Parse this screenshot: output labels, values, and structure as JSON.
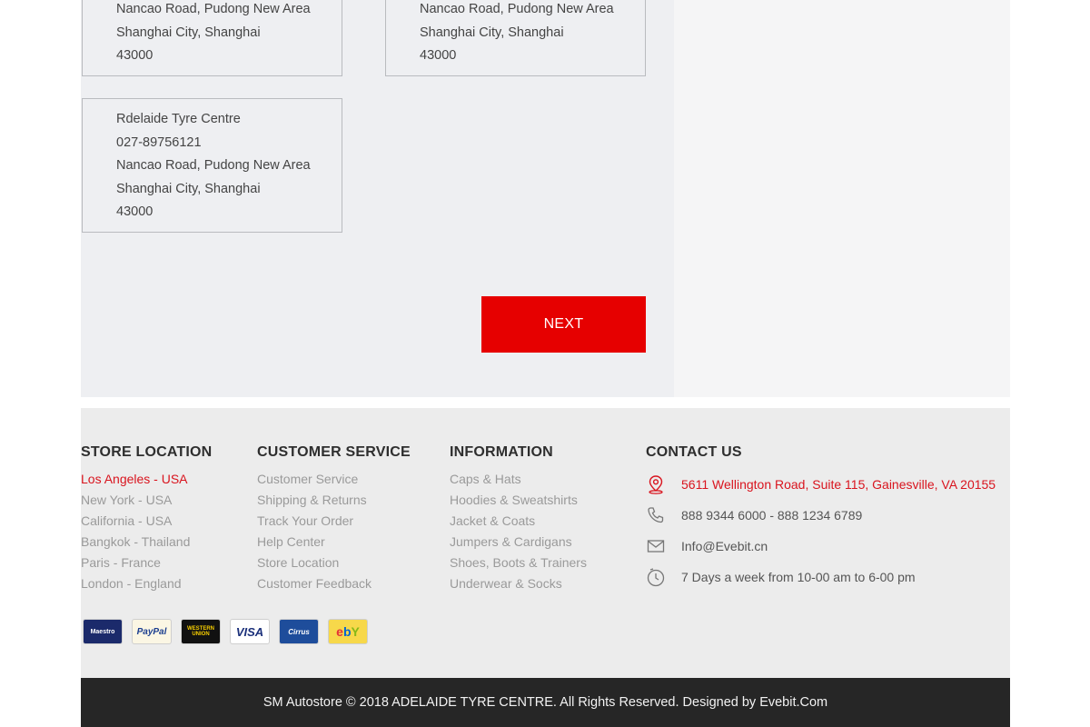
{
  "stores": [
    {
      "name": "",
      "phone": "",
      "street": "Nancao Road, Pudong New Area",
      "city": "Shanghai City, Shanghai",
      "zip": "43000"
    },
    {
      "name": "",
      "phone": "",
      "street": "Nancao Road, Pudong New Area",
      "city": "Shanghai City, Shanghai",
      "zip": "43000"
    },
    {
      "name": "Rdelaide Tyre Centre",
      "phone": "027-89756121",
      "street": "Nancao Road, Pudong New Area",
      "city": "Shanghai City, Shanghai",
      "zip": "43000"
    }
  ],
  "next_label": "NEXT",
  "footer": {
    "store_location": {
      "title": "STORE LOCATION",
      "items": [
        "Los Angeles - USA",
        "New York - USA",
        "California - USA",
        "Bangkok - Thailand",
        "Paris - France",
        "London - England"
      ]
    },
    "customer_service": {
      "title": "CUSTOMER SERVICE",
      "items": [
        "Customer Service",
        "Shipping & Returns",
        "Track Your Order",
        "Help Center",
        "Store Location",
        "Customer Feedback"
      ]
    },
    "information": {
      "title": "INFORMATION",
      "items": [
        "Caps & Hats",
        "Hoodies & Sweatshirts",
        "Jacket & Coats",
        "Jumpers & Cardigans",
        "Shoes, Boots & Trainers",
        "Underwear & Socks"
      ]
    },
    "contact": {
      "title": "CONTACT US",
      "address": "5611 Wellington Road, Suite 115, Gainesville, VA 20155",
      "phone": "888 9344 6000 - 888 1234 6789",
      "email": "Info@Evebit.cn",
      "hours": "7 Days a week from 10-00 am to 6-00 pm"
    },
    "payments": {
      "maestro": "Maestro",
      "paypal": "PayPal",
      "western_union_1": "WESTERN",
      "western_union_2": "UNION",
      "visa": "VISA",
      "cirrus": "Cirrus",
      "ebay_e": "e",
      "ebay_b": "b",
      "ebay_y": "Y"
    }
  },
  "copyright": "SM Autostore © 2018 ADELAIDE TYRE CENTRE. All Rights Reserved. Designed by Evebit.Com",
  "colors": {
    "accent": "#e60000",
    "active_link": "#d9141e",
    "footer_bar": "#262626"
  }
}
